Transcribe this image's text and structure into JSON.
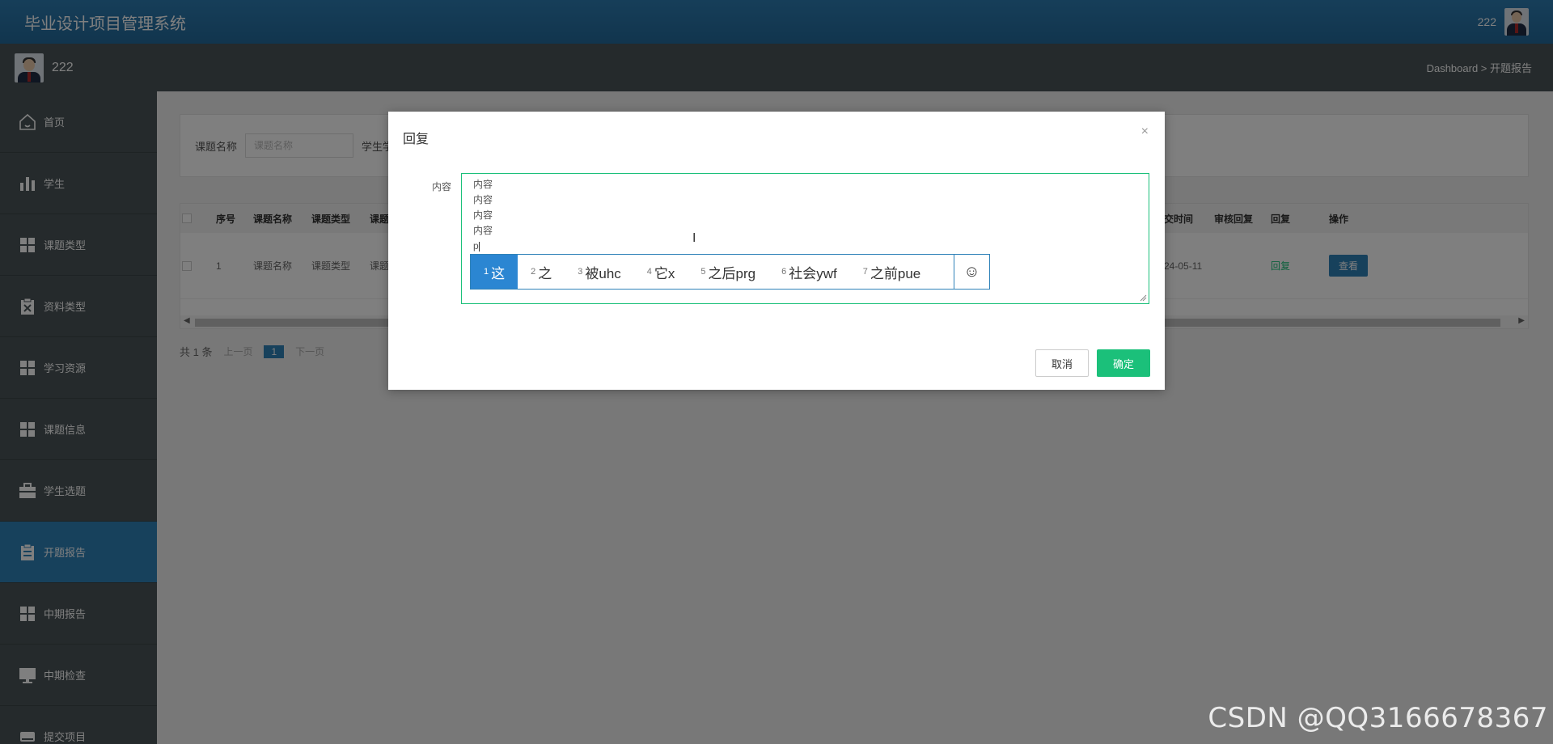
{
  "header": {
    "title": "毕业设计项目管理系统",
    "username": "222"
  },
  "subbar": {
    "username": "222",
    "breadcrumb": "Dashboard > 开题报告"
  },
  "sidebar": {
    "items": [
      {
        "label": "首页",
        "icon": "home-icon"
      },
      {
        "label": "学生",
        "icon": "bar-chart-icon"
      },
      {
        "label": "课题类型",
        "icon": "grid-icon"
      },
      {
        "label": "资料类型",
        "icon": "clipboard-x-icon"
      },
      {
        "label": "学习资源",
        "icon": "grid-icon"
      },
      {
        "label": "课题信息",
        "icon": "grid-icon"
      },
      {
        "label": "学生选题",
        "icon": "briefcase-icon"
      },
      {
        "label": "开题报告",
        "icon": "clipboard-icon"
      },
      {
        "label": "中期报告",
        "icon": "grid-icon"
      },
      {
        "label": "中期检查",
        "icon": "monitor-icon"
      },
      {
        "label": "提交项目",
        "icon": "drive-icon"
      }
    ],
    "active_index": 7
  },
  "search": {
    "label1": "课题名称",
    "placeholder1": "课题名称",
    "label2": "学生学"
  },
  "table": {
    "headers": [
      "序号",
      "课题名称",
      "课题类型",
      "课题",
      "交时间",
      "审核回复",
      "回复",
      "操作"
    ],
    "row": {
      "index": "1",
      "name": "课题名称",
      "type": "课题类型",
      "type2": "课题",
      "date": "24-05-11",
      "reply": "回复",
      "action": "查看"
    }
  },
  "pager": {
    "total": "共 1 条",
    "prev": "上一页",
    "page": "1",
    "next": "下一页"
  },
  "dialog": {
    "title": "回复",
    "close": "×",
    "field_label": "内容",
    "content_lines": [
      "内容",
      "内容",
      "内容",
      "内容"
    ],
    "typing": "p",
    "cancel_label": "取消",
    "ok_label": "确定"
  },
  "ime": {
    "candidates": [
      {
        "num": "1",
        "text": "这"
      },
      {
        "num": "2",
        "text": "之"
      },
      {
        "num": "3",
        "text": "被uhc"
      },
      {
        "num": "4",
        "text": "它x"
      },
      {
        "num": "5",
        "text": "之后prg"
      },
      {
        "num": "6",
        "text": "社会ywf"
      },
      {
        "num": "7",
        "text": "之前pue"
      }
    ],
    "emoji": "☺"
  },
  "watermark": "CSDN @QQ3166678367",
  "colors": {
    "primary": "#2f82b9",
    "success": "#1bc07a",
    "sidebar": "#4a5558"
  }
}
